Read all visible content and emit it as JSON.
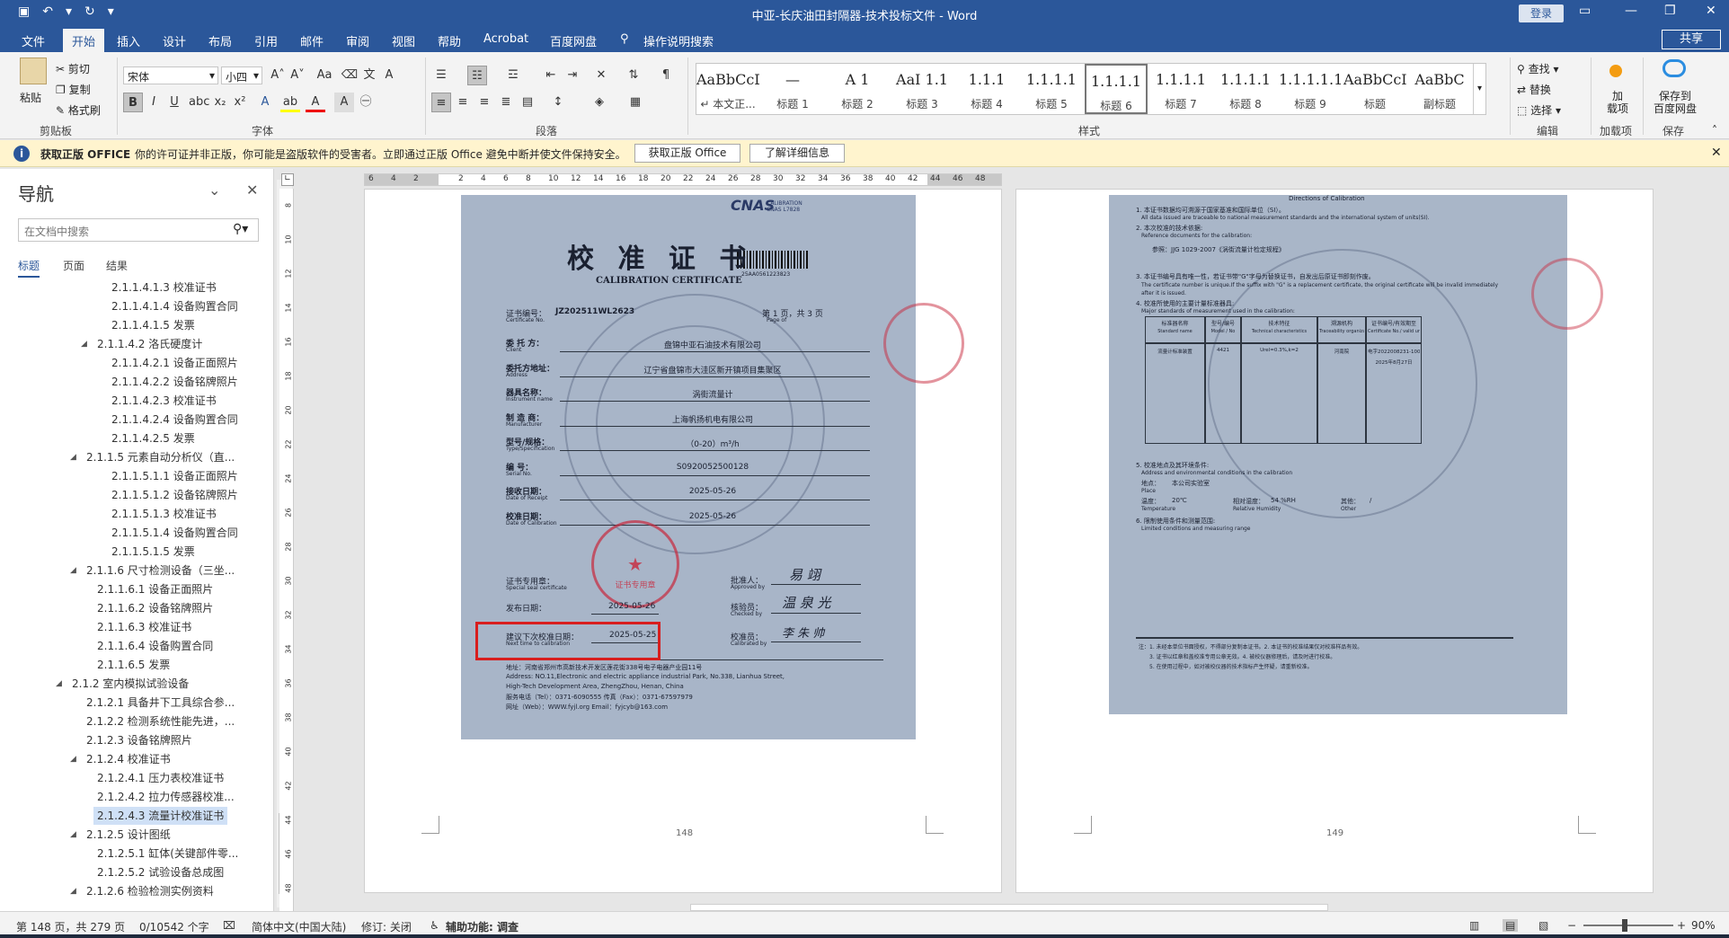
{
  "window": {
    "title": "中亚-长庆油田封隔器-技术投标文件  -  Word",
    "login": "登录",
    "share": "共享"
  },
  "qat": {
    "save": "💾",
    "undo": "↶",
    "redo": "↻"
  },
  "tabs": [
    "文件",
    "开始",
    "插入",
    "设计",
    "布局",
    "引用",
    "邮件",
    "审阅",
    "视图",
    "帮助",
    "Acrobat",
    "百度网盘"
  ],
  "tell_me": "操作说明搜索",
  "ribbon": {
    "clipboard": {
      "paste": "粘贴",
      "cut": "剪切",
      "copy": "复制",
      "painter": "格式刷",
      "label": "剪贴板"
    },
    "font": {
      "name": "宋体",
      "size": "小四",
      "label": "字体"
    },
    "paragraph": {
      "label": "段落"
    },
    "styles": {
      "label": "样式",
      "items": [
        {
          "preview": "AaBbCcDdI",
          "name": "↵ 本文正..."
        },
        {
          "preview": "—",
          "name": "标题 1"
        },
        {
          "preview": "A 1",
          "name": "标题 2"
        },
        {
          "preview": "AaI 1.1",
          "name": "标题 3"
        },
        {
          "preview": "1.1.1",
          "name": "标题 4"
        },
        {
          "preview": "1.1.1.1",
          "name": "标题 5"
        },
        {
          "preview": "1.1.1.1",
          "name": "标题 6"
        },
        {
          "preview": "1.1.1.1",
          "name": "标题 7"
        },
        {
          "preview": "1.1.1.1",
          "name": "标题 8"
        },
        {
          "preview": "1.1.1.1.1",
          "name": "标题 9"
        },
        {
          "preview": "AaBbCcI",
          "name": "标题"
        },
        {
          "preview": "AaBbC",
          "name": "副标题"
        }
      ]
    },
    "editing": {
      "find": "查找",
      "replace": "替换",
      "select": "选择",
      "label": "编辑"
    },
    "addins": {
      "add": "加\n载项",
      "label": "加载项"
    },
    "baidu": {
      "save": "保存到\n百度网盘",
      "label": "保存"
    }
  },
  "message_bar": {
    "title": "获取正版 OFFICE",
    "text": "你的许可证并非正版，你可能是盗版软件的受害者。立即通过正版 Office 避免中断并使文件保持安全。",
    "btn1": "获取正版 Office",
    "btn2": "了解详细信息"
  },
  "nav": {
    "title": "导航",
    "search_placeholder": "在文档中搜索",
    "tabs": [
      "标题",
      "页面",
      "结果"
    ],
    "items": [
      {
        "text": "2.1.1.4.1.3 校准证书",
        "level": 5
      },
      {
        "text": "2.1.1.4.1.4 设备购置合同",
        "level": 5
      },
      {
        "text": "2.1.1.4.1.5 发票",
        "level": 5
      },
      {
        "text": "2.1.1.4.2 洛氏硬度计",
        "level": 4,
        "arrow": true
      },
      {
        "text": "2.1.1.4.2.1 设备正面照片",
        "level": 5
      },
      {
        "text": "2.1.1.4.2.2 设备铭牌照片",
        "level": 5
      },
      {
        "text": "2.1.1.4.2.3 校准证书",
        "level": 5
      },
      {
        "text": "2.1.1.4.2.4 设备购置合同",
        "level": 5
      },
      {
        "text": "2.1.1.4.2.5 发票",
        "level": 5
      },
      {
        "text": "2.1.1.5 元素自动分析仪（直...",
        "level": 3,
        "arrow": true
      },
      {
        "text": "2.1.1.5.1.1 设备正面照片",
        "level": 5
      },
      {
        "text": "2.1.1.5.1.2 设备铭牌照片",
        "level": 5
      },
      {
        "text": "2.1.1.5.1.3 校准证书",
        "level": 5
      },
      {
        "text": "2.1.1.5.1.4 设备购置合同",
        "level": 5
      },
      {
        "text": "2.1.1.5.1.5 发票",
        "level": 5
      },
      {
        "text": "2.1.1.6 尺寸检测设备（三坐...",
        "level": 3,
        "arrow": true
      },
      {
        "text": "2.1.1.6.1 设备正面照片",
        "level": 4
      },
      {
        "text": "2.1.1.6.2 设备铭牌照片",
        "level": 4
      },
      {
        "text": "2.1.1.6.3 校准证书",
        "level": 4
      },
      {
        "text": "2.1.1.6.4 设备购置合同",
        "level": 4
      },
      {
        "text": "2.1.1.6.5 发票",
        "level": 4
      },
      {
        "text": "2.1.2 室内模拟试验设备",
        "level": 2,
        "arrow": true
      },
      {
        "text": "2.1.2.1 具备井下工具综合参...",
        "level": 3
      },
      {
        "text": "2.1.2.2 检测系统性能先进，...",
        "level": 3
      },
      {
        "text": "2.1.2.3 设备铭牌照片",
        "level": 3
      },
      {
        "text": "2.1.2.4 校准证书",
        "level": 3,
        "arrow": true
      },
      {
        "text": "2.1.2.4.1 压力表校准证书",
        "level": 4
      },
      {
        "text": "2.1.2.4.2 拉力传感器校准...",
        "level": 4
      },
      {
        "text": "2.1.2.4.3 流量计校准证书",
        "level": 4,
        "selected": true
      },
      {
        "text": "2.1.2.5 设计图纸",
        "level": 3,
        "arrow": true
      },
      {
        "text": "2.1.2.5.1 缸体(关键部件零...",
        "level": 4
      },
      {
        "text": "2.1.2.5.2 试验设备总成图",
        "level": 4
      },
      {
        "text": "2.1.2.6 检验检测实例资料",
        "level": 3,
        "arrow": true
      }
    ]
  },
  "ruler_ticks": [
    "6",
    "4",
    "2",
    "",
    "2",
    "4",
    "6",
    "8",
    "10",
    "12",
    "14",
    "16",
    "18",
    "20",
    "22",
    "24",
    "26",
    "28",
    "30",
    "32",
    "34",
    "36",
    "38",
    "40",
    "42",
    "44",
    "46",
    "48"
  ],
  "vruler_ticks": [
    "8",
    "10",
    "12",
    "14",
    "16",
    "18",
    "20",
    "22",
    "24",
    "26",
    "28",
    "30",
    "32",
    "34",
    "36",
    "38",
    "40",
    "42",
    "44",
    "46",
    "48"
  ],
  "cert1": {
    "title": "校 准 证 书",
    "subtitle": "CALIBRATION CERTIFICATE",
    "cert_no_label": "证书编号：",
    "cert_no_en": "Certificate No.",
    "cert_no": "JZ202511WL2623",
    "page": "第 1 页，共  3  页",
    "page_en": "Page          of",
    "client_label": "委  托  方：",
    "client_en": "Client",
    "client": "盘锦中亚石油技术有限公司",
    "address_label": "委托方地址：",
    "address_en": "Address",
    "address": "辽宁省盘锦市大洼区新开镇项目集聚区",
    "instrument_label": "器具名称：",
    "instrument_en": "Instrument name",
    "instrument": "涡街流量计",
    "manufacturer_label": "制  造  商：",
    "manufacturer_en": "Manufacturer",
    "manufacturer": "上海帆扬机电有限公司",
    "type_label": "型号/规格：",
    "type_en": "Type/Specification",
    "type": "（0-20）m³/h",
    "serial_label": "编      号：",
    "serial_en": "Serial No.",
    "serial": "S0920052500128",
    "receipt_label": "接收日期：",
    "receipt_en": "Date of Receipt",
    "receipt": "2025-05-26",
    "calib_label": "校准日期：",
    "calib_en": "Date of Calibration",
    "calib": "2025-05-26",
    "seal_label": "证书专用章：",
    "seal_en": "Special seal certificate",
    "issue_label": "发布日期：",
    "issue": "2025-05-26",
    "next_label": "建议下次校准日期：",
    "next_en": "Next time to calibration",
    "next": "2025-05-25",
    "approved_label": "批准人：",
    "approved_en": "Approved by",
    "approved": "易 翊",
    "checked_label": "核验员：",
    "checked_en": "Checked by",
    "checked": "温 泉 光",
    "calibrated_label": "校准员：",
    "calibrated_en": "Calibrated by",
    "calibrated": "李 朱 帅",
    "addr1": "地址：河南省郑州市高新技术开发区莲花街338号电子电器产业园11号",
    "addr2": "Address: NO.11,Electronic and electric appliance industrial Park, No.338, Lianhua Street,",
    "addr3": "High-Tech Development Area, ZhengZhou, Henan, China",
    "tel": "服务电话（Tel）：0371-6090555        传真（Fax）：0371-67597979",
    "web": "网址（Web）：WWW.fyjl.org           Email：fyjcyb@163.com",
    "cnas": "CNAS",
    "barcode": "25AA0561223823",
    "stamp_text": "证书专用章",
    "page_num": "148"
  },
  "cert2": {
    "heading": "Directions of Calibration",
    "l1": "1. 本证书数据均可溯源于国家基准和国际单位（SI）。",
    "l1en": "All data issued are traceable to national measurement standards and the international system of units(SI).",
    "l2": "2. 本次校准的技术依据:",
    "l2en": "Reference documents for the calibration:",
    "l2v": "参照：JJG 1029-2007《涡街流量计检定规程》",
    "l3": "3. 本证书编号具有唯一性，若证书带\"G\"字母为替换证书，自发出后原证书即刻作废。",
    "l3en": "The certificate number is unique.If the suffix with \"G\" is a replacement certificate, the original certificate will be invalid immediately after it is issued.",
    "l4": "4. 校准所使用的主要计量标准器具:",
    "l4en": "Major standards of measurement used in the calibration:",
    "headers": [
      "标准器名称",
      "型号/编号",
      "技术特征",
      "溯源机构",
      "证书编号/有效期至"
    ],
    "headers_en": [
      "Standard name",
      "Model / No",
      "Technical characteristics",
      "Traceability organization",
      "Certificate No./ valid until"
    ],
    "row": [
      "流量计标准装置",
      "4421",
      "Urel=0.3%,k=2",
      "河南院",
      "电字2022008231-1000"
    ],
    "row2": "2025年8月27日",
    "l5": "5. 校准地点及其环境条件:",
    "l5en": "Address and environmental conditions in the calibration",
    "place_label": "地点：",
    "place": "本公司实验室",
    "place_en": "Place",
    "temp_label": "温度：",
    "temp": "20℃",
    "humid_label": "相对湿度：",
    "humid": "54  %RH",
    "other_label": "其他：",
    "other": "/",
    "temp_en": "Temperature",
    "humid_en": "Relative Humidity",
    "other_en": "Other",
    "l6": "6. 限制使用条件和测量范围:",
    "l6en": "Limited conditions and measuring range",
    "notes": "注：1. 未经本单位书面授权，不得部分复制本证书。2. 本证书的校准结果仅对校准样品有效。",
    "notes2": "3. 证书以红章和盖校准专用公章无效。4. 被校仪器修理后，请及时进行校准。",
    "notes3": "5. 在使用过程中，如对被校仪器的技术指标产生怀疑，请重新校准。",
    "page_num": "149"
  },
  "status": {
    "page": "第 148 页，共 279 页",
    "words": "0/10542 个字",
    "lang": "简体中文(中国大陆)",
    "track": "修订: 关闭",
    "access": "辅助功能: 调查",
    "zoom": "90%"
  }
}
